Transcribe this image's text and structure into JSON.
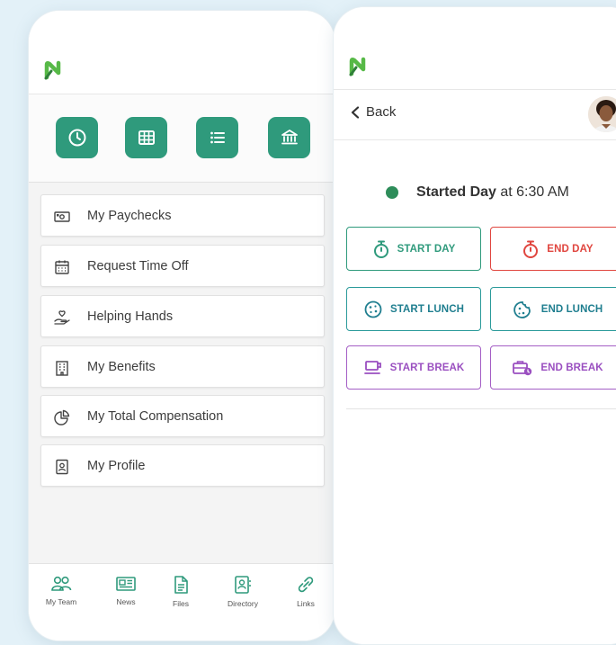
{
  "left_phone": {
    "quick_tiles": [
      {
        "icon": "clock-icon"
      },
      {
        "icon": "calendar-grid-icon"
      },
      {
        "icon": "list-icon"
      },
      {
        "icon": "bank-icon"
      }
    ],
    "menu": [
      {
        "label": "My Paychecks",
        "icon": "money-icon"
      },
      {
        "label": "Request Time Off",
        "icon": "calendar-icon"
      },
      {
        "label": "Helping Hands",
        "icon": "hand-heart-icon"
      },
      {
        "label": "My Benefits",
        "icon": "building-icon"
      },
      {
        "label": "My Total Compensation",
        "icon": "pie-chart-icon"
      },
      {
        "label": "My Profile",
        "icon": "profile-icon"
      }
    ],
    "bottom_nav": [
      {
        "label": "My Team",
        "icon": "team-icon"
      },
      {
        "label": "News",
        "icon": "news-icon"
      },
      {
        "label": "Files",
        "icon": "file-icon"
      },
      {
        "label": "Directory",
        "icon": "directory-icon"
      },
      {
        "label": "Links",
        "icon": "link-icon"
      }
    ]
  },
  "right_phone": {
    "back_label": "Back",
    "status": {
      "bold": "Started Day",
      "rest": " at 6:30 AM",
      "dot_color": "#2e8d5a"
    },
    "actions": [
      {
        "label": "START DAY",
        "icon": "stopwatch-icon",
        "color": "#2f9a7c"
      },
      {
        "label": "END DAY",
        "icon": "stopwatch-icon",
        "color": "#e0463f"
      },
      {
        "label": "START LUNCH",
        "icon": "cookie-icon",
        "color": "#2a9a9a"
      },
      {
        "label": "END LUNCH",
        "icon": "cookie-bite-icon",
        "color": "#2a9a9a"
      },
      {
        "label": "START BREAK",
        "icon": "coffee-cup-icon",
        "color": "#a45ec5"
      },
      {
        "label": "END BREAK",
        "icon": "briefcase-clock-icon",
        "color": "#a45ec5"
      }
    ]
  },
  "colors": {
    "brand_green": "#2f9a7c",
    "logo_green": "#57b947",
    "background": "#e3f1f8"
  }
}
